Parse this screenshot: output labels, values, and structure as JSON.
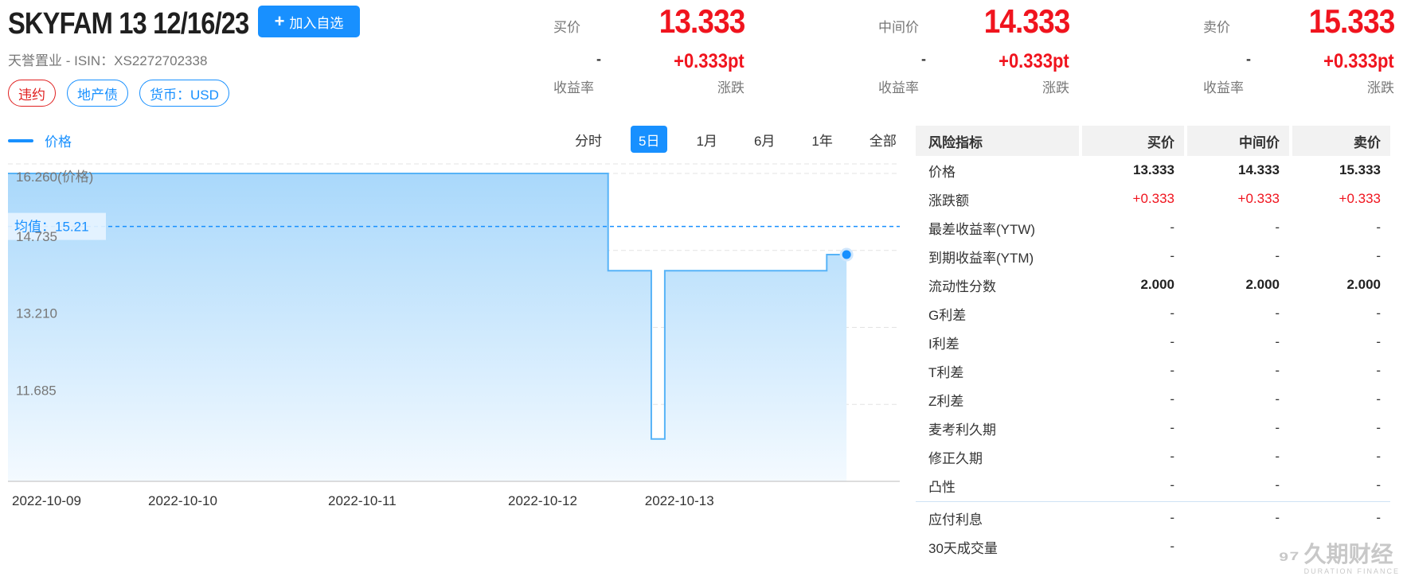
{
  "header": {
    "title": "SKYFAM 13 12/16/23",
    "watch_button": "加入自选",
    "issuer_isin": "天誉置业 - ISIN：XS2272702338",
    "tags": [
      {
        "label": "违约",
        "color": "#e02020"
      },
      {
        "label": "地产债",
        "color": "#1890ff"
      },
      {
        "label": "货币：USD",
        "color": "#1890ff"
      }
    ]
  },
  "quotes": [
    {
      "label": "买价",
      "price": "13.333",
      "yield_value": "-",
      "change": "+0.333pt",
      "yield_label": "收益率",
      "change_label": "涨跌"
    },
    {
      "label": "中间价",
      "price": "14.333",
      "yield_value": "-",
      "change": "+0.333pt",
      "yield_label": "收益率",
      "change_label": "涨跌"
    },
    {
      "label": "卖价",
      "price": "15.333",
      "yield_value": "-",
      "change": "+0.333pt",
      "yield_label": "收益率",
      "change_label": "涨跌"
    }
  ],
  "chart_controls": {
    "legend": "价格",
    "ranges": [
      "分时",
      "5日",
      "1月",
      "6月",
      "1年",
      "全部"
    ],
    "active_range": "5日"
  },
  "chart_data": {
    "type": "area",
    "series": [
      {
        "name": "价格",
        "color": "#1890ff"
      }
    ],
    "step_points": [
      {
        "t": 0.0,
        "y": 16.26
      },
      {
        "t": 3.335,
        "y": 16.26
      },
      {
        "t": 3.335,
        "y": 14.333
      },
      {
        "t": 3.575,
        "y": 14.333
      },
      {
        "t": 3.575,
        "y": 11.0
      },
      {
        "t": 3.65,
        "y": 11.0
      },
      {
        "t": 3.65,
        "y": 14.333
      },
      {
        "t": 4.55,
        "y": 14.333
      },
      {
        "t": 4.55,
        "y": 14.653
      },
      {
        "t": 4.66,
        "y": 14.653
      }
    ],
    "x_ticks": [
      {
        "t": 0,
        "label": "2022-10-09"
      },
      {
        "t": 1,
        "label": "2022-10-10"
      },
      {
        "t": 2,
        "label": "2022-10-11"
      },
      {
        "t": 3,
        "label": "2022-10-12"
      },
      {
        "t": 3.76,
        "label": "2022-10-13"
      }
    ],
    "y_ticks": [
      16.26,
      14.735,
      13.21,
      11.685
    ],
    "y_top_label": "16.260(价格)",
    "ylim": [
      10.16,
      16.26
    ],
    "mean_label": "均值：15.21",
    "mean_value": 15.21,
    "grid": true
  },
  "risk_table": {
    "headers": [
      "风险指标",
      "买价",
      "中间价",
      "卖价"
    ],
    "rows": [
      {
        "name": "价格",
        "bid": "13.333",
        "mid": "14.333",
        "ask": "15.333",
        "style": "num"
      },
      {
        "name": "涨跌额",
        "bid": "+0.333",
        "mid": "+0.333",
        "ask": "+0.333",
        "style": "red"
      },
      {
        "name": "最差收益率(YTW)",
        "bid": "-",
        "mid": "-",
        "ask": "-",
        "style": "plain"
      },
      {
        "name": "到期收益率(YTM)",
        "bid": "-",
        "mid": "-",
        "ask": "-",
        "style": "plain"
      },
      {
        "name": "流动性分数",
        "bid": "2.000",
        "mid": "2.000",
        "ask": "2.000",
        "style": "num"
      },
      {
        "name": "G利差",
        "bid": "-",
        "mid": "-",
        "ask": "-",
        "style": "plain"
      },
      {
        "name": "I利差",
        "bid": "-",
        "mid": "-",
        "ask": "-",
        "style": "plain"
      },
      {
        "name": "T利差",
        "bid": "-",
        "mid": "-",
        "ask": "-",
        "style": "plain"
      },
      {
        "name": "Z利差",
        "bid": "-",
        "mid": "-",
        "ask": "-",
        "style": "plain"
      },
      {
        "name": "麦考利久期",
        "bid": "-",
        "mid": "-",
        "ask": "-",
        "style": "plain"
      },
      {
        "name": "修正久期",
        "bid": "-",
        "mid": "-",
        "ask": "-",
        "style": "plain"
      },
      {
        "name": "凸性",
        "bid": "-",
        "mid": "-",
        "ask": "-",
        "style": "plain"
      }
    ],
    "rows_after_divider": [
      {
        "name": "应付利息",
        "bid": "-",
        "mid": "-",
        "ask": "-",
        "style": "plain"
      },
      {
        "name": "30天成交量",
        "bid": "-",
        "mid": "",
        "ask": "",
        "style": "plain"
      }
    ]
  },
  "watermark": {
    "logo": "久期财经",
    "sub": "DURATION FINANCE",
    "icon": "duration-logo-icon"
  },
  "colors": {
    "accent": "#1890ff",
    "up": "#f0141e",
    "default_tag": "#e02020"
  }
}
